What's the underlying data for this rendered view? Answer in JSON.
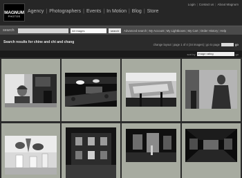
{
  "header": {
    "logo_line1": "MAGNUM",
    "logo_line2": "PHOTOS",
    "nav": [
      "Agency",
      "Photographers",
      "Events",
      "In Motion",
      "Blog",
      "Store"
    ],
    "top_links": [
      "Login",
      "Contact us",
      "About Magnum"
    ]
  },
  "search": {
    "label": "search",
    "input_value": "",
    "scope_selected": "All images",
    "button_label": "search",
    "links": [
      "Advanced search",
      "My Account",
      "My Lightboxes",
      "My Cart",
      "Order History",
      "Help"
    ]
  },
  "results": {
    "title": "Search results for chine and chi and chang"
  },
  "pager": {
    "change_layout": "change layout",
    "page_info": "page 1 of 4 (34 images)",
    "go_to_page": "go to page",
    "page_input_value": "",
    "go": "go"
  },
  "sort": {
    "label": "sort by",
    "selected": "image rating",
    "go": "go"
  },
  "thumbnails": [
    {
      "subject": "man-with-helmet-bw-photo"
    },
    {
      "subject": "crowd-and-cars-at-night-photo"
    },
    {
      "subject": "large-sign-over-building-photo"
    },
    {
      "subject": "shadow-figure-on-wall-photo"
    },
    {
      "subject": "lotus-flowers-in-vases-photo"
    },
    {
      "subject": "colonial-building-facade-photo"
    },
    {
      "subject": "exhibition-interior-photo"
    },
    {
      "subject": "gallery-hall-photo"
    }
  ]
}
